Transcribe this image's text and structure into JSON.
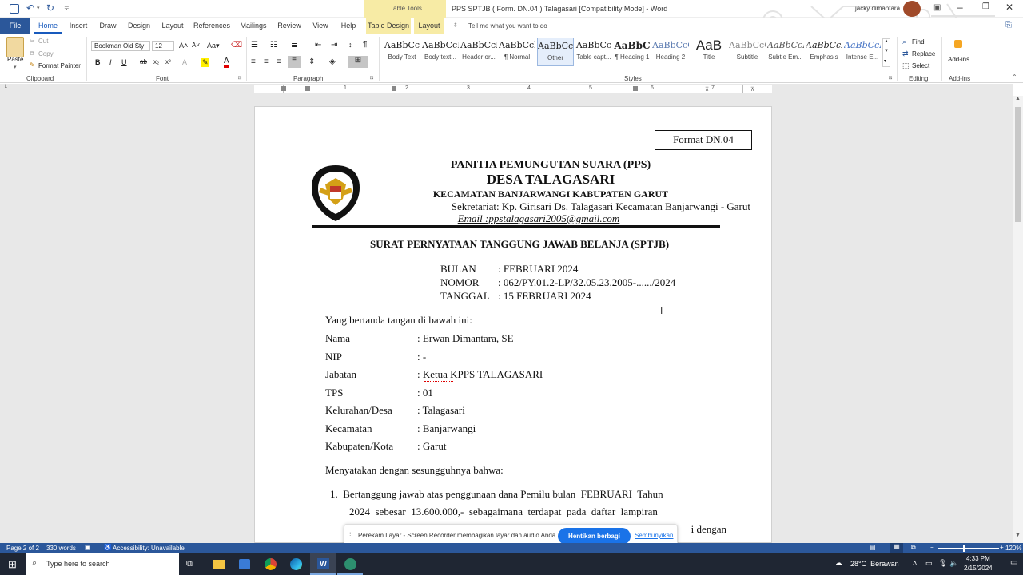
{
  "window": {
    "title": "PPS SPTJB ( Form. DN.04 ) Talagasari [Compatibility Mode] - Word",
    "table_tools": "Table Tools",
    "user": "jacky dimantara"
  },
  "tabs": [
    "File",
    "Home",
    "Insert",
    "Draw",
    "Design",
    "Layout",
    "References",
    "Mailings",
    "Review",
    "View",
    "Help",
    "Table Design",
    "Layout"
  ],
  "tell_me": "Tell me what you want to do",
  "ribbon": {
    "clipboard": {
      "paste": "Paste",
      "cut": "Cut",
      "copy": "Copy",
      "format_painter": "Format Painter",
      "label": "Clipboard"
    },
    "font": {
      "name": "Bookman Old Sty",
      "size": "12",
      "label": "Font"
    },
    "paragraph_label": "Paragraph",
    "styles_label": "Styles",
    "styles": [
      {
        "sample": "AaBbCc",
        "name": "Body Text"
      },
      {
        "sample": "AaBbCcD",
        "name": "Body text..."
      },
      {
        "sample": "AaBbCcDc",
        "name": "Header or..."
      },
      {
        "sample": "AaBbCcl",
        "name": "¶ Normal"
      },
      {
        "sample": "AaBbCc",
        "name": "Other"
      },
      {
        "sample": "AaBbCc",
        "name": "Table capt..."
      },
      {
        "sample": "AaBbC",
        "name": "¶ Heading 1"
      },
      {
        "sample": "AaBbCcC",
        "name": "Heading 2"
      },
      {
        "sample": "AaB",
        "name": "Title"
      },
      {
        "sample": "AaBbCcC",
        "name": "Subtitle"
      },
      {
        "sample": "AaBbCcI",
        "name": "Subtle Em..."
      },
      {
        "sample": "AaBbCcI",
        "name": "Emphasis"
      },
      {
        "sample": "AaBbCcI",
        "name": "Intense E..."
      }
    ],
    "editing": {
      "find": "Find",
      "replace": "Replace",
      "select": "Select",
      "label": "Editing"
    },
    "addins": {
      "button": "Add-ins",
      "label": "Add-ins"
    }
  },
  "ruler_numbers": [
    "1",
    "2",
    "3",
    "4",
    "5",
    "6",
    "7"
  ],
  "document": {
    "format_box": "Format DN.04",
    "logo_text": "PANITIA PEMUNGUTAN SUARA",
    "h1": "PANITIA PEMUNGUTAN SUARA (PPS)",
    "h2": "DESA TALAGASARI",
    "h3": "KECAMATAN BANJARWANGI KABUPATEN GARUT",
    "secretariat": "Sekretariat: Kp. Girisari Ds. Talagasari Kecamatan Banjarwangi - Garut",
    "email": "Email :ppstalagasari2005@gmail.com",
    "doc_title": "SURAT PERNYATAAN TANGGUNG JAWAB BELANJA (SPTJB)",
    "meta": [
      {
        "k": "BULAN",
        "v": ": FEBRUARI 2024"
      },
      {
        "k": "NOMOR",
        "v": ": 062/PY.01.2-LP/32.05.23.2005-....../2024"
      },
      {
        "k": "TANGGAL",
        "v": ": 15 FEBRUARI 2024"
      }
    ],
    "intro": "Yang bertanda tangan di bawah ini:",
    "fields": [
      {
        "k": "Nama",
        "v": ": Erwan Dimantara, SE"
      },
      {
        "k": "NIP",
        "v": ": -"
      },
      {
        "k": "Jabatan",
        "v": ": Ketua KPPS TALAGASARI"
      },
      {
        "k": "TPS",
        "v": ": 01"
      },
      {
        "k": "Kelurahan/Desa",
        "v": ": Talagasari"
      },
      {
        "k": "Kecamatan",
        "v": ": Banjarwangi"
      },
      {
        "k": "Kabupaten/Kota",
        "v": ": Garut"
      }
    ],
    "declare": "Menyatakan dengan sesungguhnya bahwa:",
    "item1_line1": "1.  Bertanggung jawab atas penggunaan dana Pemilu bulan  FEBRUARI  Tahun",
    "item1_line2": "2024  sebesar  13.600.000,-  sebagaimana  terdapat  pada  daftar  lampiran",
    "item1_line3": "i dengan"
  },
  "share_bar": {
    "message": "Perekam Layar - Screen Recorder membagikan layar dan audio Anda.",
    "stop": "Hentikan berbagi",
    "hide": "Sembunyikan"
  },
  "status": {
    "page": "Page 2 of 2",
    "words": "330 words",
    "accessibility": "Accessibility: Unavailable",
    "zoom": "120%"
  },
  "taskbar": {
    "search": "Type here to search",
    "weather": "28°C  Berawan",
    "time": "4:33 PM",
    "date": "2/15/2024"
  },
  "colors": {
    "word_blue": "#2b579a",
    "accent": "#185abd",
    "share_btn": "#1a73e8"
  }
}
